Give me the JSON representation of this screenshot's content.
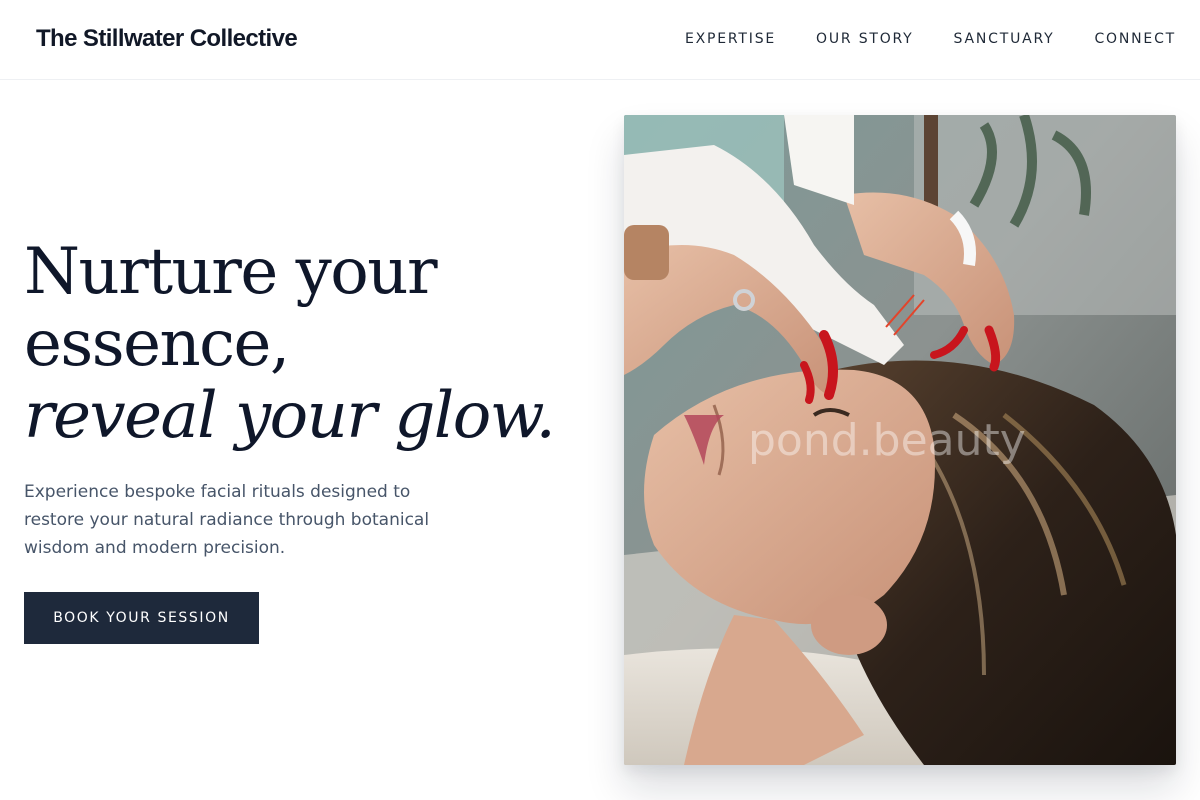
{
  "brand": {
    "name": "The Stillwater Collective"
  },
  "nav": {
    "items": [
      {
        "label": "EXPERTISE"
      },
      {
        "label": "OUR STORY"
      },
      {
        "label": "SANCTUARY"
      },
      {
        "label": "CONNECT"
      }
    ]
  },
  "hero": {
    "title_line1": "Nurture your essence,",
    "title_line2": "reveal your glow.",
    "subtitle": "Experience bespoke facial rituals designed to restore your natural radiance through botanical wisdom and modern precision.",
    "cta_label": "BOOK YOUR SESSION"
  },
  "photo": {
    "watermark": "pond.beauty"
  },
  "colors": {
    "primary_dark": "#1e293b",
    "heading": "#0f172a",
    "body_text": "#475569",
    "nail_red": "#c8151d"
  }
}
